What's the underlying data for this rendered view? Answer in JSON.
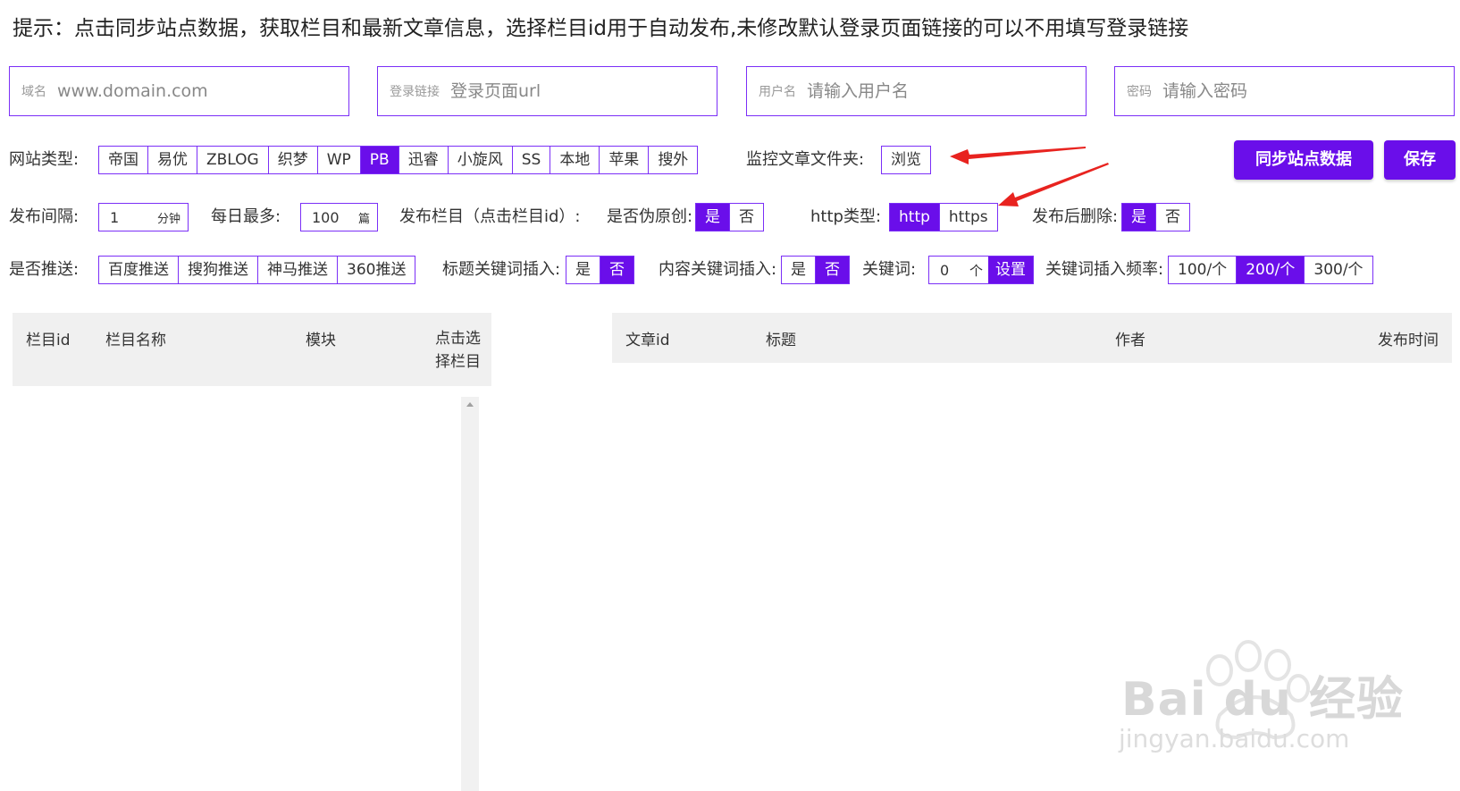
{
  "tip": "提示：点击同步站点数据，获取栏目和最新文章信息，选择栏目id用于自动发布,未修改默认登录页面链接的可以不用填写登录链接",
  "fields": {
    "domain": {
      "label": "域名",
      "placeholder": "www.domain.com"
    },
    "login_url": {
      "label": "登录链接",
      "placeholder": "登录页面url"
    },
    "username": {
      "label": "用户名",
      "placeholder": "请输入用户名"
    },
    "password": {
      "label": "密码",
      "placeholder": "请输入密码"
    }
  },
  "site_type": {
    "label": "网站类型:",
    "options": [
      "帝国",
      "易优",
      "ZBLOG",
      "织梦",
      "WP",
      "PB",
      "迅睿",
      "小旋风",
      "SS",
      "本地",
      "苹果",
      "搜外"
    ],
    "selected": "PB"
  },
  "monitor": {
    "label": "监控文章文件夹:",
    "browse": "浏览"
  },
  "buttons": {
    "sync": "同步站点数据",
    "save": "保存"
  },
  "interval": {
    "label": "发布间隔:",
    "value": "1",
    "unit": "分钟"
  },
  "daily_max": {
    "label": "每日最多:",
    "value": "100",
    "unit": "篇"
  },
  "publish_column": {
    "label": "发布栏目（点击栏目id）:"
  },
  "pseudo_original": {
    "label": "是否伪原创:",
    "options": [
      "是",
      "否"
    ],
    "selected": "是"
  },
  "http_type": {
    "label": "http类型:",
    "options": [
      "http",
      "https"
    ],
    "selected": "http"
  },
  "delete_after": {
    "label": "发布后删除:",
    "options": [
      "是",
      "否"
    ],
    "selected": "是"
  },
  "push": {
    "label": "是否推送:",
    "options": [
      "百度推送",
      "搜狗推送",
      "神马推送",
      "360推送"
    ]
  },
  "title_kw": {
    "label": "标题关键词插入:",
    "options": [
      "是",
      "否"
    ],
    "selected": "否"
  },
  "content_kw": {
    "label": "内容关键词插入:",
    "options": [
      "是",
      "否"
    ],
    "selected": "否"
  },
  "keywords": {
    "label": "关键词:",
    "value": "0",
    "unit": "个",
    "set": "设置"
  },
  "kw_freq": {
    "label": "关键词插入频率:",
    "options": [
      "100/个",
      "200/个",
      "300/个"
    ],
    "selected": "200/个"
  },
  "column_table": {
    "headers": [
      "栏目id",
      "栏目名称",
      "模块",
      "点击选择栏目"
    ]
  },
  "article_table": {
    "headers": [
      "文章id",
      "标题",
      "作者",
      "发布时间"
    ]
  },
  "watermark": {
    "main": "Bai du 经验",
    "sub": "jingyan.baidu.com"
  },
  "colors": {
    "accent": "#6a0eea",
    "border": "#7b2ff7",
    "arrow": "#e8231f"
  }
}
